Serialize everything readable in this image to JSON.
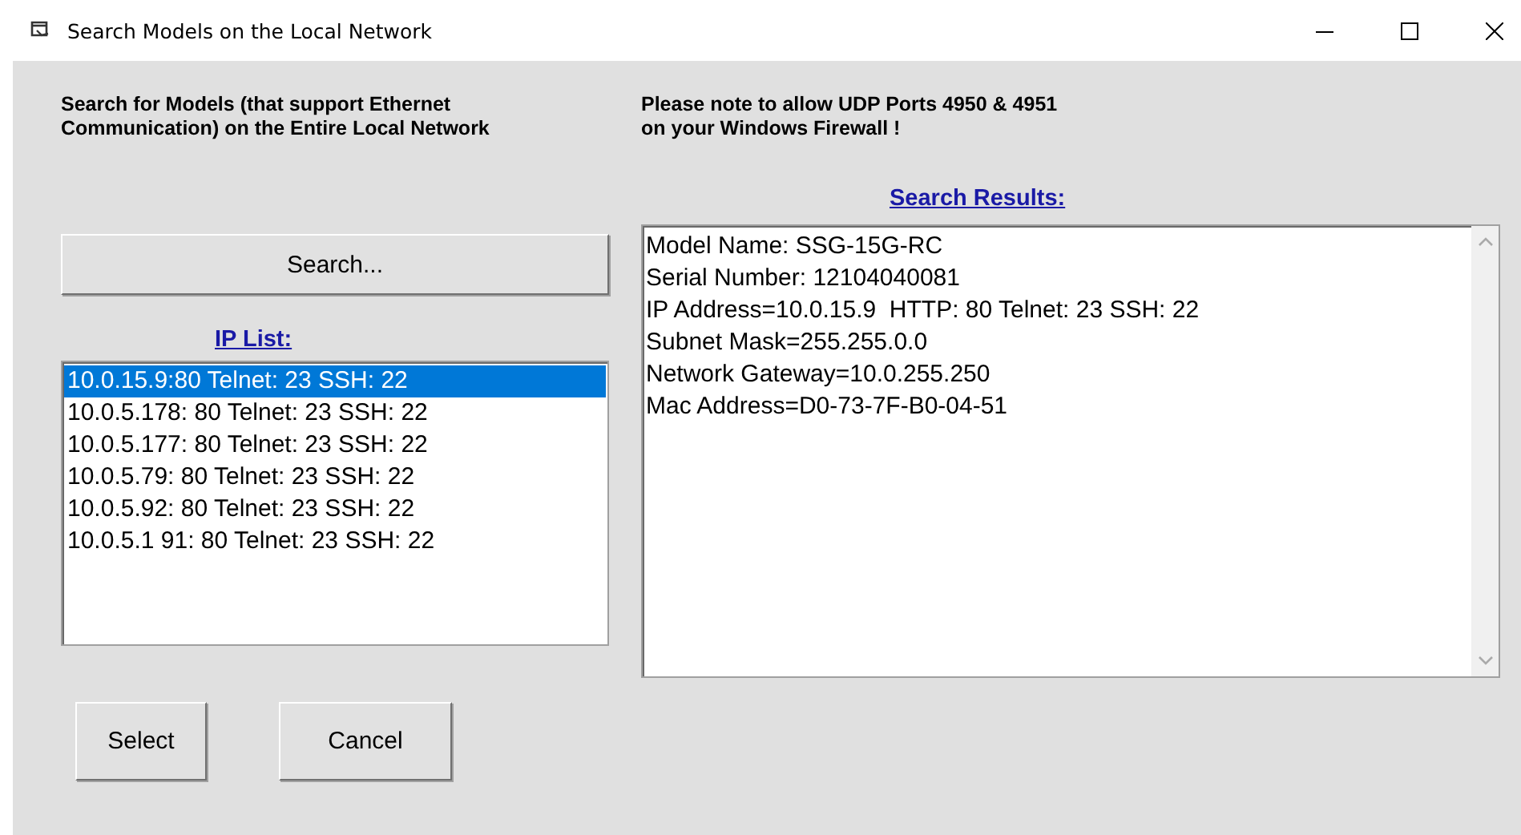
{
  "window": {
    "title": "Search Models on the Local Network"
  },
  "intro": "Search for Models (that support Ethernet\nCommunication) on the Entire Local Network",
  "note": "Please note to allow UDP Ports 4950 & 4951\non your Windows Firewall !",
  "search_button": "Search...",
  "ip_list": {
    "label": "IP List:",
    "items": [
      {
        "text": "10.0.15.9:80 Telnet: 23 SSH: 22",
        "selected": true
      },
      {
        "text": "10.0.5.178: 80 Telnet: 23 SSH: 22",
        "selected": false
      },
      {
        "text": "10.0.5.177: 80 Telnet: 23 SSH: 22",
        "selected": false
      },
      {
        "text": "10.0.5.79: 80 Telnet: 23 SSH: 22",
        "selected": false
      },
      {
        "text": "10.0.5.92: 80 Telnet: 23 SSH: 22",
        "selected": false
      },
      {
        "text": "10.0.5.1 91: 80 Telnet: 23 SSH: 22",
        "selected": false
      }
    ]
  },
  "search_results": {
    "label": "Search Results:",
    "lines": [
      "Model Name: SSG-15G-RC",
      "Serial Number: 12104040081",
      "IP Address=10.0.15.9  HTTP: 80 Telnet: 23 SSH: 22",
      "Subnet Mask=255.255.0.0",
      "Network Gateway=10.0.255.250",
      "Mac Address=D0-73-7F-B0-04-51"
    ]
  },
  "buttons": [
    "Select",
    "Cancel"
  ]
}
